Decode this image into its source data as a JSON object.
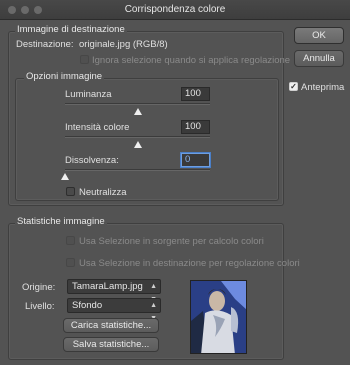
{
  "window": {
    "title": "Corrispondenza colore"
  },
  "destination": {
    "group_title": "Immagine di destinazione",
    "label": "Destinazione:",
    "value": "originale.jpg (RGB/8)",
    "ignore_selection_label": "Ignora selezione quando si applica regolazione",
    "ignore_selection_checked": false
  },
  "options": {
    "group_title": "Opzioni immagine",
    "luminance": {
      "label": "Luminanza",
      "value": "100",
      "level_fraction": 0.5
    },
    "color_intensity": {
      "label": "Intensità colore",
      "value": "100",
      "level_fraction": 0.5
    },
    "fade": {
      "label": "Dissolvenza:",
      "value": "0",
      "level_fraction": 0.0
    },
    "neutralize": {
      "label": "Neutralizza",
      "checked": false
    }
  },
  "stats": {
    "group_title": "Statistiche immagine",
    "use_source_selection_label": "Usa Selezione in sorgente per calcolo colori",
    "use_dest_selection_label": "Usa Selezione in destinazione per regolazione colori",
    "source_label": "Origine:",
    "source_value": "TamaraLamp.jpg",
    "layer_label": "Livello:",
    "layer_value": "Sfondo",
    "load_button": "Carica statistiche...",
    "save_button": "Salva statistiche..."
  },
  "buttons": {
    "ok": "OK",
    "cancel": "Annulla"
  },
  "preview_checkbox": {
    "label": "Anteprima",
    "checked": true
  },
  "colors": {
    "accent_focus": "#4a7fc8",
    "dialog_bg": "#535353"
  },
  "icons": [
    "window-controls-icon",
    "checkmark-icon",
    "dropdown-arrow-icon",
    "slider-thumb-icon"
  ]
}
